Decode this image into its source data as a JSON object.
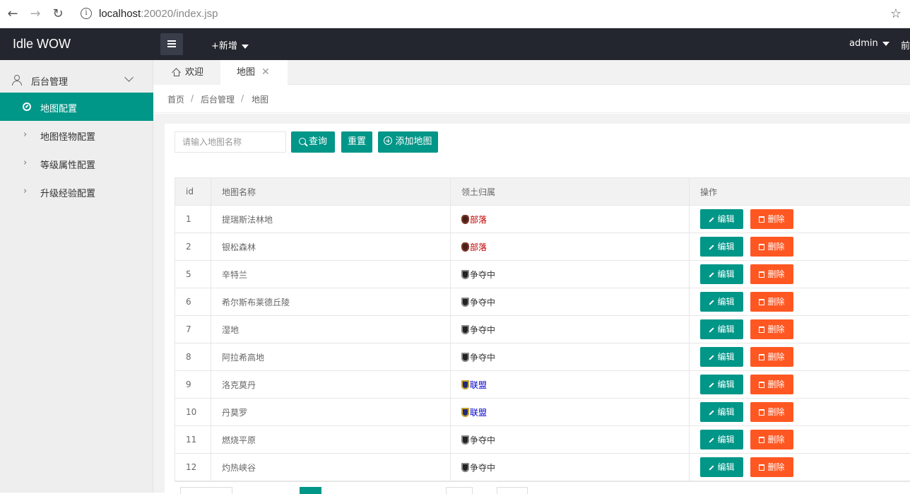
{
  "browser": {
    "url_host": "localhost",
    "url_rest": ":20020/index.jsp"
  },
  "header": {
    "logo": "Idle WOW",
    "add_new": "+新增",
    "user": "admin",
    "front_link": "前"
  },
  "sidebar": {
    "group_label": "后台管理",
    "items": [
      {
        "label": "地图配置",
        "active": true
      },
      {
        "label": "地图怪物配置"
      },
      {
        "label": "等级属性配置"
      },
      {
        "label": "升级经验配置"
      }
    ]
  },
  "tabs": [
    {
      "label": "欢迎"
    },
    {
      "label": "地图",
      "close": "✕"
    }
  ],
  "breadcrumb": [
    "首页",
    "后台管理",
    "地图"
  ],
  "breadcrumb_sep": "/",
  "toolbar": {
    "search_placeholder": "请输入地图名称",
    "search_label": "查询",
    "reset_label": "重置",
    "add_label": "添加地图"
  },
  "table": {
    "headers": [
      "id",
      "地图名称",
      "领土归属",
      "操作"
    ],
    "edit_label": "编辑",
    "delete_label": "删除",
    "rows": [
      {
        "id": "1",
        "name": "提瑞斯法林地",
        "faction": "部落",
        "faction_type": "horde"
      },
      {
        "id": "2",
        "name": "银松森林",
        "faction": "部落",
        "faction_type": "horde"
      },
      {
        "id": "5",
        "name": "辛特兰",
        "faction": "争夺中",
        "faction_type": "contested"
      },
      {
        "id": "6",
        "name": "希尔斯布莱德丘陵",
        "faction": "争夺中",
        "faction_type": "contested"
      },
      {
        "id": "7",
        "name": "湿地",
        "faction": "争夺中",
        "faction_type": "contested"
      },
      {
        "id": "8",
        "name": "阿拉希高地",
        "faction": "争夺中",
        "faction_type": "contested"
      },
      {
        "id": "9",
        "name": "洛克莫丹",
        "faction": "联盟",
        "faction_type": "alliance"
      },
      {
        "id": "10",
        "name": "丹莫罗",
        "faction": "联盟",
        "faction_type": "alliance"
      },
      {
        "id": "11",
        "name": "燃烧平原",
        "faction": "争夺中",
        "faction_type": "contested"
      },
      {
        "id": "12",
        "name": "灼热峡谷",
        "faction": "争夺中",
        "faction_type": "contested"
      }
    ]
  },
  "colors": {
    "accent": "#009688",
    "danger": "#ff5722",
    "header_bg": "#23262e",
    "horde": "#c00000",
    "alliance": "#0000cc"
  }
}
